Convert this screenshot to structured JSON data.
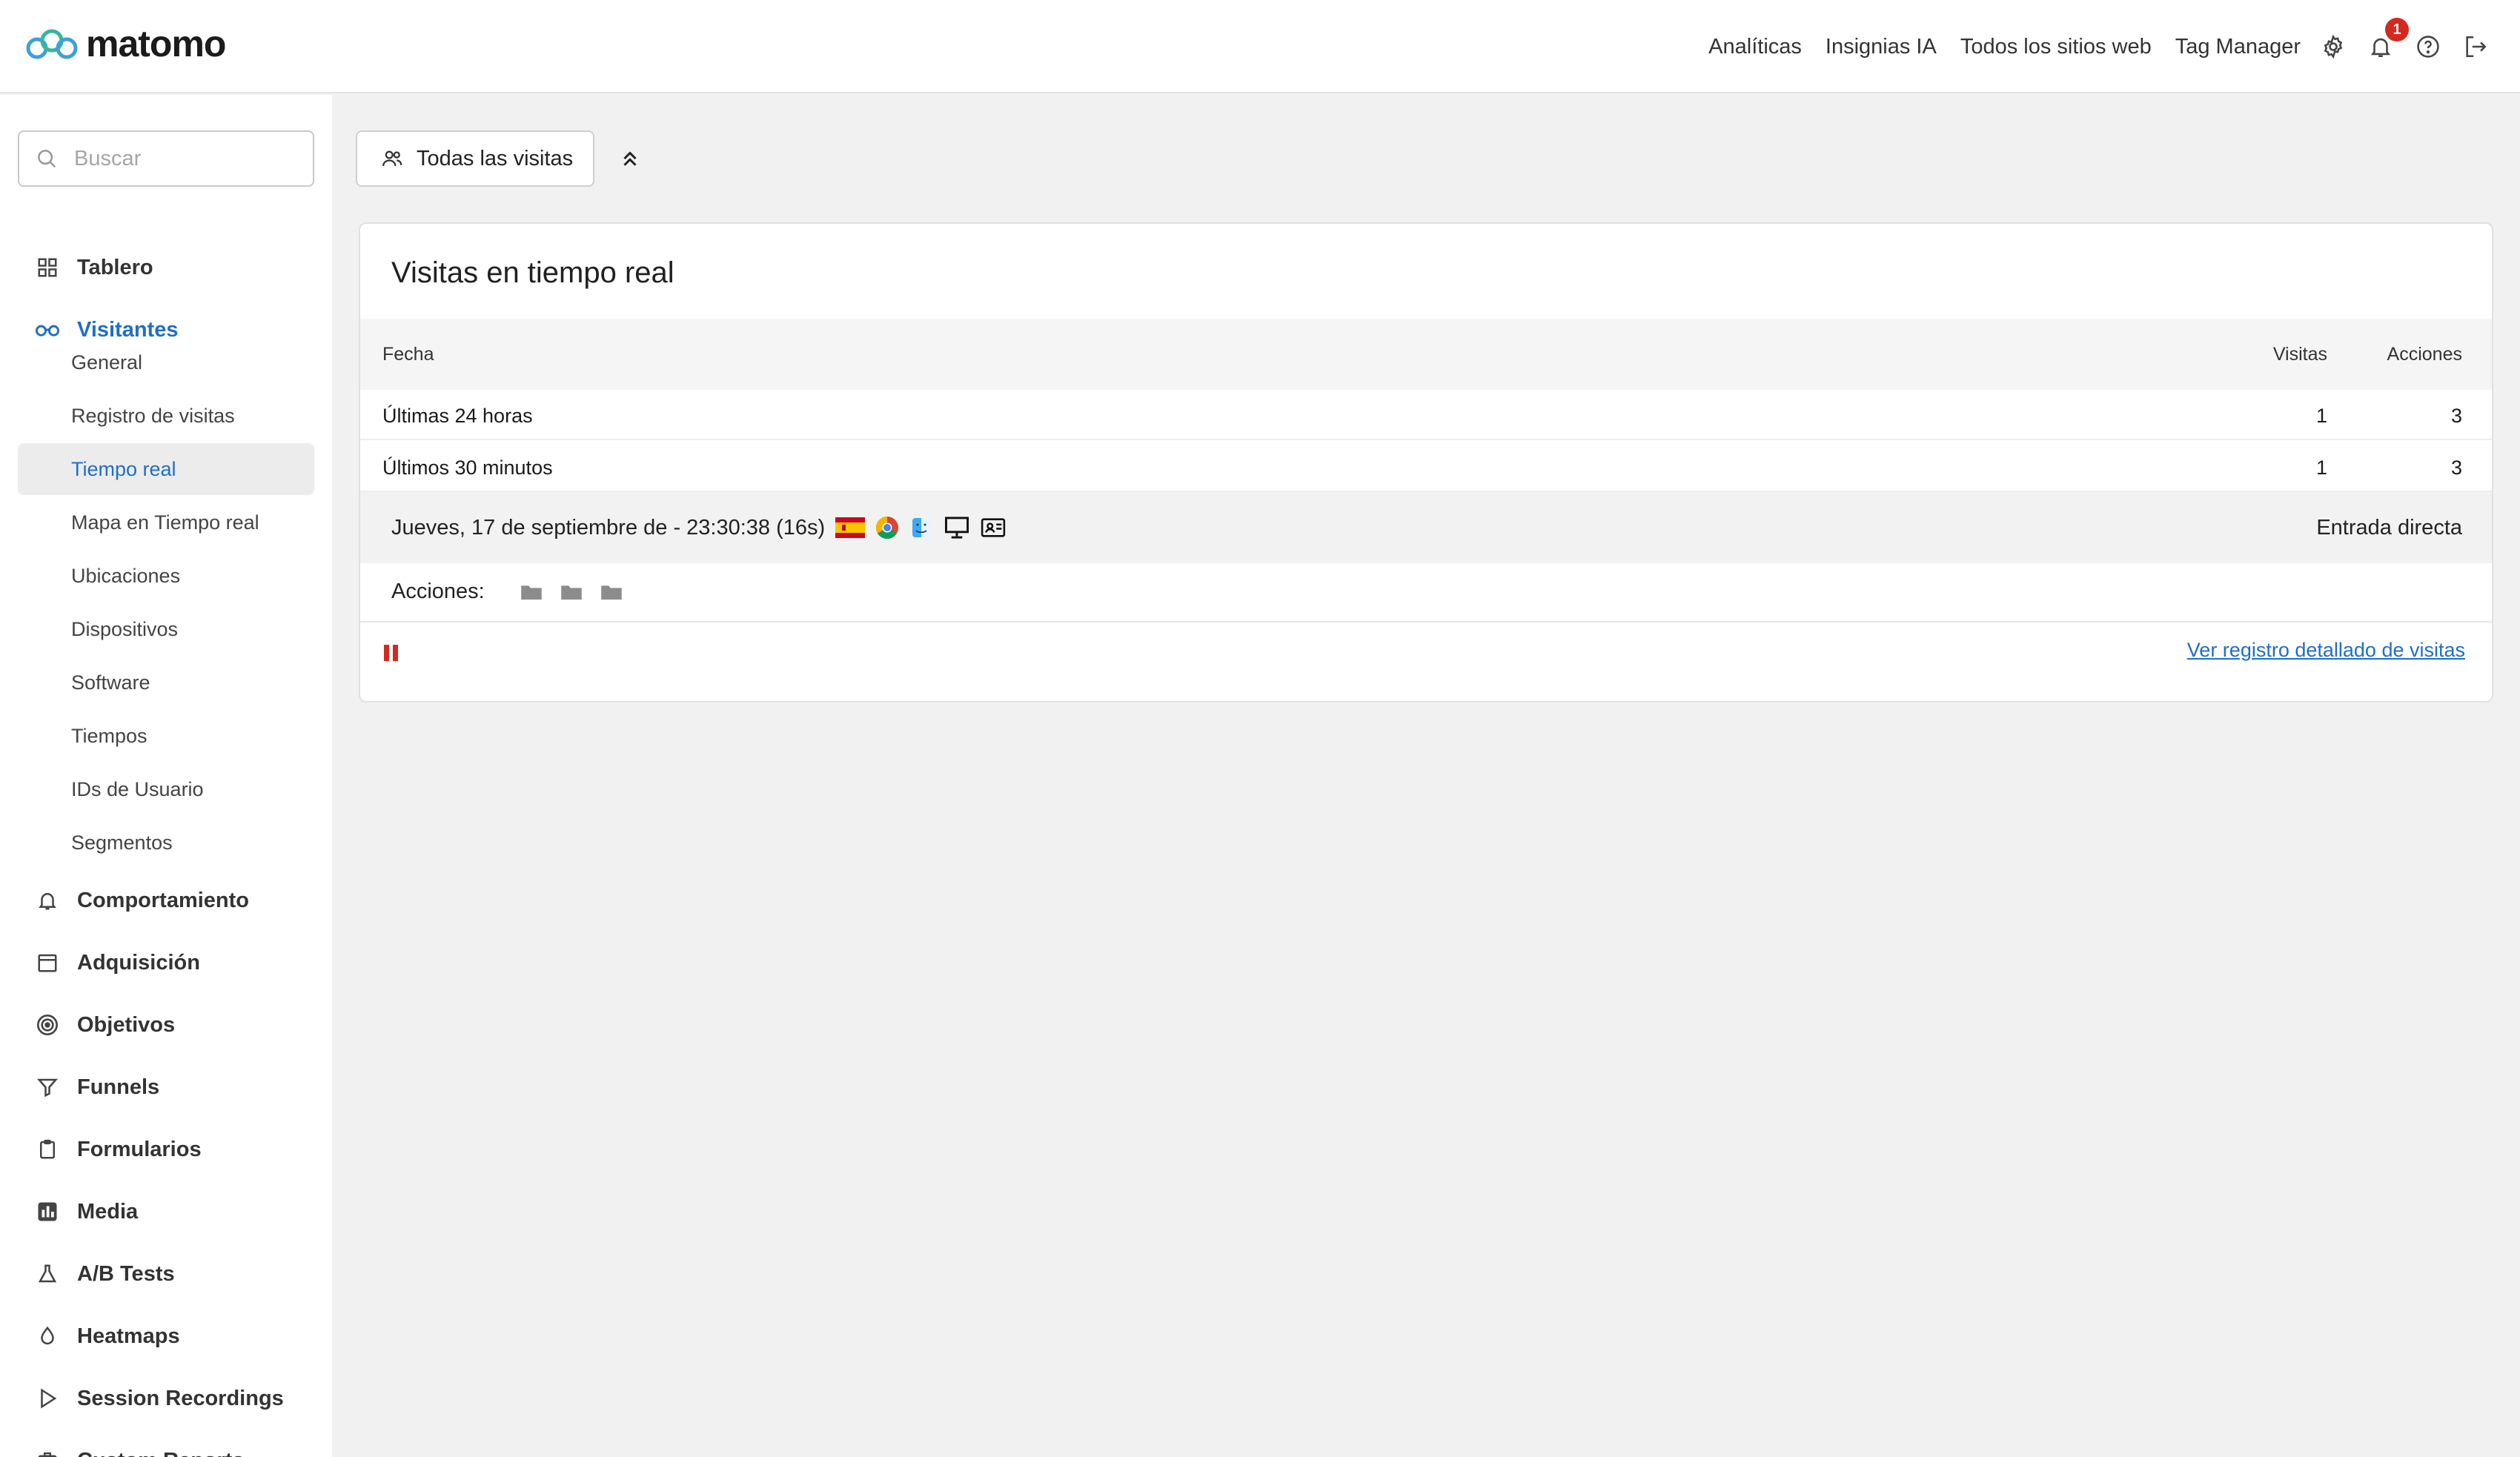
{
  "header": {
    "logo_text": "matomo",
    "nav": [
      "Analíticas",
      "Insignias IA",
      "Todos los sitios web",
      "Tag Manager"
    ],
    "notification_count": "1",
    "icons": [
      "gear-icon",
      "bell-icon",
      "help-icon",
      "logout-icon"
    ]
  },
  "sidebar": {
    "search_placeholder": "Buscar",
    "sections": [
      {
        "label": "Tablero",
        "icon": "grid-icon"
      },
      {
        "label": "Visitantes",
        "icon": "binoculars-icon",
        "active": true
      },
      {
        "label": "Comportamiento",
        "icon": "bell-icon"
      },
      {
        "label": "Adquisición",
        "icon": "calendar-icon"
      },
      {
        "label": "Objetivos",
        "icon": "target-icon"
      },
      {
        "label": "Funnels",
        "icon": "filter-icon"
      },
      {
        "label": "Formularios",
        "icon": "clipboard-icon"
      },
      {
        "label": "Media",
        "icon": "media-chart-icon"
      },
      {
        "label": "A/B Tests",
        "icon": "flask-icon"
      },
      {
        "label": "Heatmaps",
        "icon": "drop-icon"
      },
      {
        "label": "Session Recordings",
        "icon": "play-icon"
      },
      {
        "label": "Custom Reports",
        "icon": "briefcase-icon"
      }
    ],
    "visitor_items": [
      "General",
      "Registro de visitas",
      "Tiempo real",
      "Mapa en Tiempo real",
      "Ubicaciones",
      "Dispositivos",
      "Software",
      "Tiempos",
      "IDs de Usuario",
      "Segmentos"
    ],
    "active_item": "Tiempo real"
  },
  "segment": {
    "label": "Todas las visitas"
  },
  "realtime": {
    "title": "Visitas en tiempo real",
    "columns": [
      "Fecha",
      "Visitas",
      "Acciones"
    ],
    "rows": [
      {
        "period": "Últimas 24 horas",
        "visits": "1",
        "actions": "3"
      },
      {
        "period": "Últimos 30 minutos",
        "visits": "1",
        "actions": "3"
      }
    ],
    "visit": {
      "datetime": "Jueves, 17 de septiembre de - 23:30:38 (16s)",
      "referrer": "Entrada directa",
      "icons": [
        "flag-spain-icon",
        "chrome-icon",
        "finder-icon",
        "desktop-icon",
        "visitor-profile-icon"
      ]
    },
    "actions_label": "Acciones:",
    "action_icons": [
      "folder-icon",
      "folder-icon",
      "folder-icon"
    ],
    "detail_link": "Ver registro detallado de visitas"
  },
  "colors": {
    "accent": "#1f6fc5",
    "badge": "#d4291f",
    "pause": "#d4291f"
  }
}
